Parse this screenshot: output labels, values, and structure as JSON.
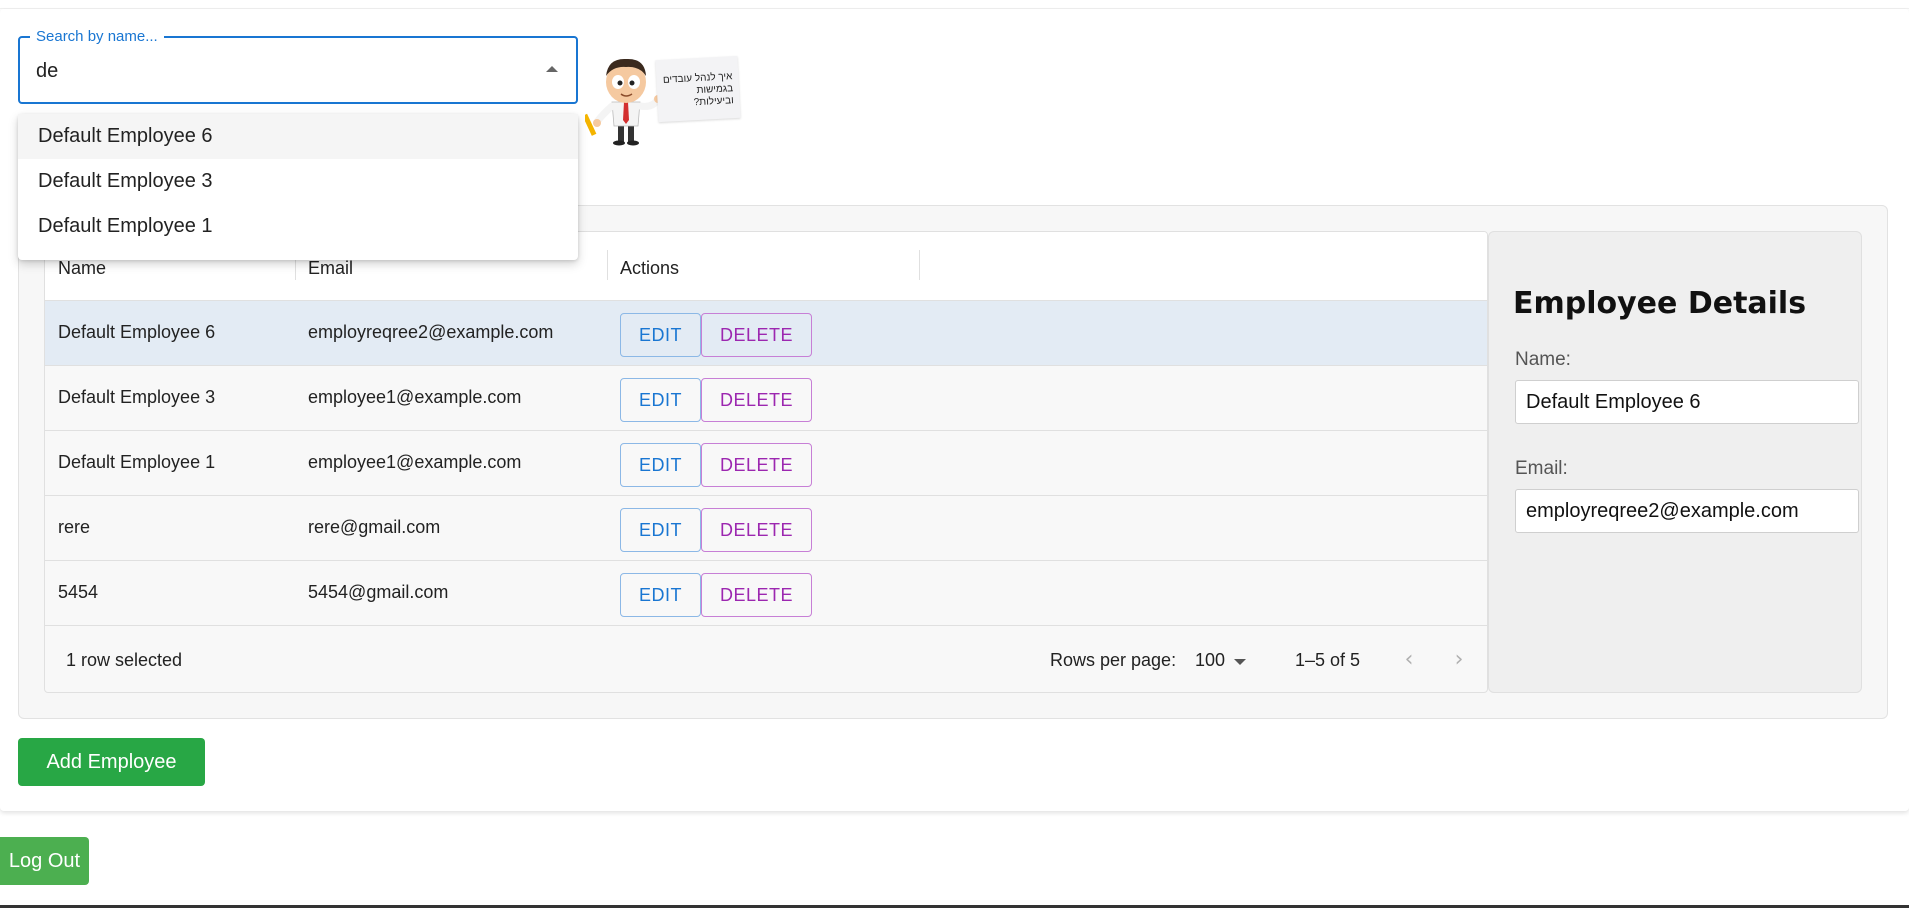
{
  "search": {
    "label": "Search by name...",
    "value": "de",
    "options": [
      "Default Employee 6",
      "Default Employee 3",
      "Default Employee 1"
    ]
  },
  "mascot": {
    "sign_line1": "איך לנהל עובדים",
    "sign_line2": "בגמישות וביעילות?"
  },
  "grid": {
    "columns": {
      "name": "Name",
      "email": "Email",
      "actions": "Actions"
    },
    "edit_label": "EDIT",
    "delete_label": "DELETE",
    "rows": [
      {
        "name": "Default Employee 6",
        "email": "employreqree2@example.com",
        "selected": true
      },
      {
        "name": "Default Employee 3",
        "email": "employee1@example.com",
        "selected": false
      },
      {
        "name": "Default Employee 1",
        "email": "employee1@example.com",
        "selected": false
      },
      {
        "name": "rere",
        "email": "rere@gmail.com",
        "selected": false
      },
      {
        "name": "5454",
        "email": "5454@gmail.com",
        "selected": false
      }
    ],
    "footer": {
      "selection": "1 row selected",
      "rows_per_page_label": "Rows per page:",
      "rows_per_page_value": "100",
      "range": "1–5 of 5"
    }
  },
  "details": {
    "title": "Employee Details",
    "name_label": "Name:",
    "name_value": "Default Employee 6",
    "email_label": "Email:",
    "email_value": "employreqree2@example.com"
  },
  "buttons": {
    "add": "Add Employee",
    "logout": "Log Out"
  },
  "colors": {
    "primary": "#1976d2",
    "secondary": "#9c27b0",
    "add_button": "#28a745",
    "logout_button": "#4caf50",
    "selected_row": "#e3ebf4"
  },
  "icons": {
    "dropdown_open": "caret-up-icon",
    "rows_select": "caret-down-icon",
    "prev_page": "chevron-left-icon",
    "next_page": "chevron-right-icon"
  }
}
